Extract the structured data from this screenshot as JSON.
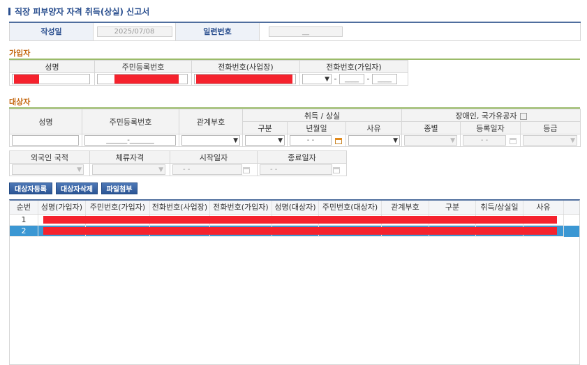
{
  "page": {
    "title": "직장 피부양자 자격 취득(상실) 신고서"
  },
  "header": {
    "written_date_label": "작성일",
    "written_date": "2025/07/08",
    "serial_label": "일련번호",
    "serial_value": "__"
  },
  "subscriber": {
    "section_label": "가입자",
    "col_name": "성명",
    "col_rrn": "주민등록번호",
    "col_phone_workplace": "전화번호(사업장)",
    "col_phone_subscriber": "전화번호(가입자)",
    "phone_dash": "-",
    "phone_part2": "____",
    "phone_part3": "____"
  },
  "target": {
    "section_label": "대상자",
    "col_name": "성명",
    "col_rrn": "주민등록번호",
    "col_relation": "관계부호",
    "col_acq_loss": "취득 / 상실",
    "col_type": "구분",
    "col_date": "년월일",
    "col_reason": "사유",
    "col_disabled": "장애인, 국가유공자",
    "col_kind": "종별",
    "col_reg_date": "등록일자",
    "col_grade": "등급",
    "rrn_placeholder": "______-_______",
    "date_placeholder": "-  -",
    "col_nationality": "외국인 국적",
    "col_visa": "체류자격",
    "col_start": "시작일자",
    "col_end": "종료일자"
  },
  "buttons": {
    "register": "대상자등록",
    "delete": "대상자삭제",
    "attach": "파일첨부"
  },
  "list": {
    "columns": [
      "순번",
      "성명(가입자)",
      "주민번호(가입자)",
      "전화번호(사업장)",
      "전화번호(가입자)",
      "성명(대상자)",
      "주민번호(대상자)",
      "관계부호",
      "구분",
      "취득/상실일",
      "사유"
    ],
    "rows": [
      {
        "no": "1",
        "selected": false
      },
      {
        "no": "2",
        "selected": true
      }
    ]
  },
  "colors": {
    "accent": "#2a4f8f",
    "section": "#c56a14",
    "selected_row": "#3b97d3",
    "redaction": "#f5222d"
  }
}
